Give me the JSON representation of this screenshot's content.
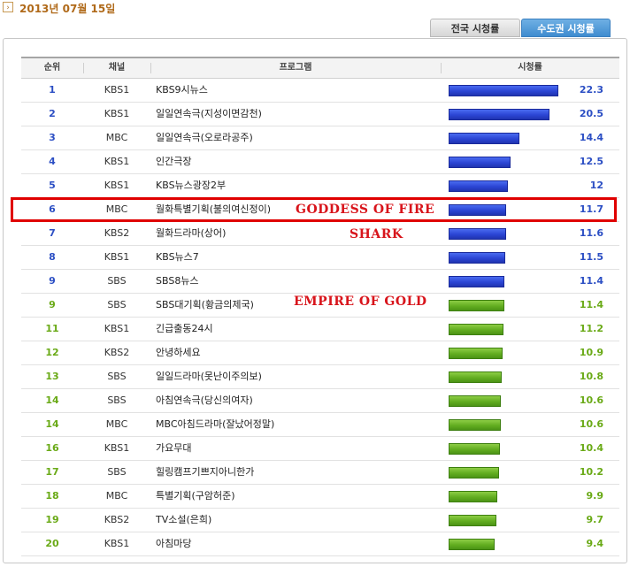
{
  "date": "2013년 07월 15일",
  "tabs": {
    "national": "전국 시청률",
    "capital": "수도권 시청률"
  },
  "headers": {
    "rank": "순위",
    "channel": "채널",
    "program": "프로그램",
    "rating": "시청률"
  },
  "bar_max_rating": 22.3,
  "colors": {
    "blue_rank": "#2c4fc4",
    "green_rank": "#6aaa17",
    "highlight": "#e00000",
    "annotation": "#d8141b"
  },
  "annotations": {
    "goddess": "GODDESS OF FIRE",
    "shark": "SHARK",
    "empire": "EMPIRE OF GOLD"
  },
  "rows": [
    {
      "rank": "1",
      "channel": "KBS1",
      "program": "KBS9시뉴스",
      "rating": "22.3",
      "color": "blue"
    },
    {
      "rank": "2",
      "channel": "KBS1",
      "program": "일일연속극(지성이면감천)",
      "rating": "20.5",
      "color": "blue"
    },
    {
      "rank": "3",
      "channel": "MBC",
      "program": "일일연속극(오로라공주)",
      "rating": "14.4",
      "color": "blue"
    },
    {
      "rank": "4",
      "channel": "KBS1",
      "program": "인간극장",
      "rating": "12.5",
      "color": "blue"
    },
    {
      "rank": "5",
      "channel": "KBS1",
      "program": "KBS뉴스광장2부",
      "rating": "12",
      "color": "blue"
    },
    {
      "rank": "6",
      "channel": "MBC",
      "program": "월화특별기획(불의여신정이)",
      "rating": "11.7",
      "color": "blue"
    },
    {
      "rank": "7",
      "channel": "KBS2",
      "program": "월화드라마(상어)",
      "rating": "11.6",
      "color": "blue"
    },
    {
      "rank": "8",
      "channel": "KBS1",
      "program": "KBS뉴스7",
      "rating": "11.5",
      "color": "blue"
    },
    {
      "rank": "9",
      "channel": "SBS",
      "program": "SBS8뉴스",
      "rating": "11.4",
      "color": "blue"
    },
    {
      "rank": "9",
      "channel": "SBS",
      "program": "SBS대기획(황금의제국)",
      "rating": "11.4",
      "color": "green"
    },
    {
      "rank": "11",
      "channel": "KBS1",
      "program": "긴급출동24시",
      "rating": "11.2",
      "color": "green"
    },
    {
      "rank": "12",
      "channel": "KBS2",
      "program": "안녕하세요",
      "rating": "10.9",
      "color": "green"
    },
    {
      "rank": "13",
      "channel": "SBS",
      "program": "일일드라마(못난이주의보)",
      "rating": "10.8",
      "color": "green"
    },
    {
      "rank": "14",
      "channel": "SBS",
      "program": "아침연속극(당신의여자)",
      "rating": "10.6",
      "color": "green"
    },
    {
      "rank": "14",
      "channel": "MBC",
      "program": "MBC아침드라마(잘났어정말)",
      "rating": "10.6",
      "color": "green"
    },
    {
      "rank": "16",
      "channel": "KBS1",
      "program": "가요무대",
      "rating": "10.4",
      "color": "green"
    },
    {
      "rank": "17",
      "channel": "SBS",
      "program": "힐링캠프기쁘지아니한가",
      "rating": "10.2",
      "color": "green"
    },
    {
      "rank": "18",
      "channel": "MBC",
      "program": "특별기획(구암허준)",
      "rating": "9.9",
      "color": "green"
    },
    {
      "rank": "19",
      "channel": "KBS2",
      "program": "TV소설(은희)",
      "rating": "9.7",
      "color": "green"
    },
    {
      "rank": "20",
      "channel": "KBS1",
      "program": "아침마당",
      "rating": "9.4",
      "color": "green"
    }
  ]
}
